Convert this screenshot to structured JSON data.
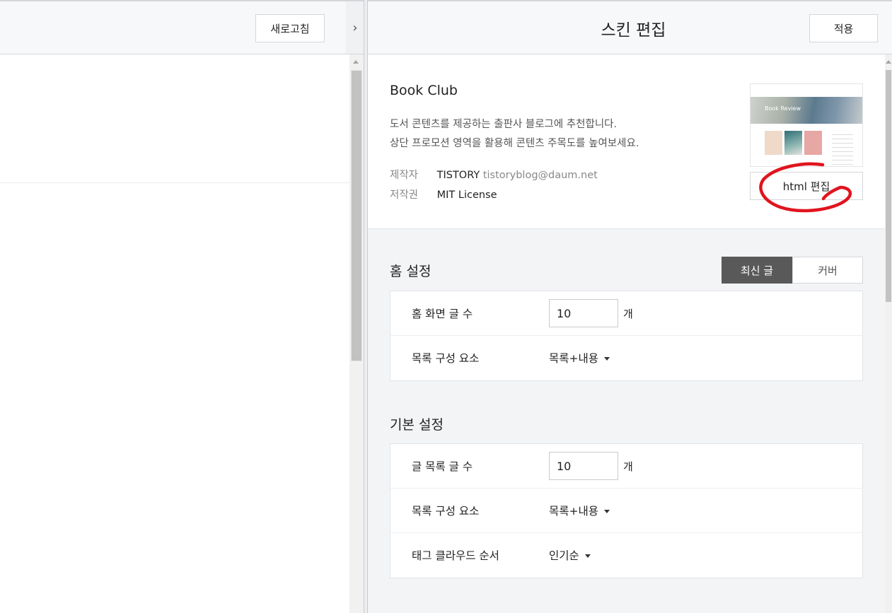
{
  "left": {
    "refresh_label": "새로고침"
  },
  "split": {
    "toggle_glyph": "›"
  },
  "right": {
    "title": "스킨 편집",
    "apply_label": "적용",
    "skin": {
      "name": "Book Club",
      "desc_line1": "도서 콘텐츠를 제공하는 출판사 블로그에 추천합니다.",
      "desc_line2": "상단 프로모션 영역을 활용해 콘텐츠 주목도를 높여보세요.",
      "author_key": "제작자",
      "author_name": "TISTORY",
      "author_email": "tistoryblog@daum.net",
      "license_key": "저작권",
      "license_value": "MIT License",
      "thumb_hero_text": "Book Review",
      "html_edit_label": "html 편집"
    },
    "home_settings": {
      "title": "홈 설정",
      "toggle": {
        "latest": "최신 글",
        "cover": "커버",
        "selected": "최신 글"
      },
      "rows": [
        {
          "label": "홈 화면 글 수",
          "value": "10",
          "unit": "개"
        },
        {
          "label": "목록 구성 요소",
          "selected": "목록+내용"
        }
      ]
    },
    "basic_settings": {
      "title": "기본 설정",
      "rows": [
        {
          "label": "글 목록 글 수",
          "value": "10",
          "unit": "개"
        },
        {
          "label": "목록 구성 요소",
          "selected": "목록+내용"
        },
        {
          "label": "태그 클라우드 순서",
          "selected": "인기순"
        }
      ]
    }
  },
  "colors": {
    "toggle_active_bg": "#595959",
    "annotation_red": "#e0141e",
    "panel_bg": "#f3f4f6"
  }
}
